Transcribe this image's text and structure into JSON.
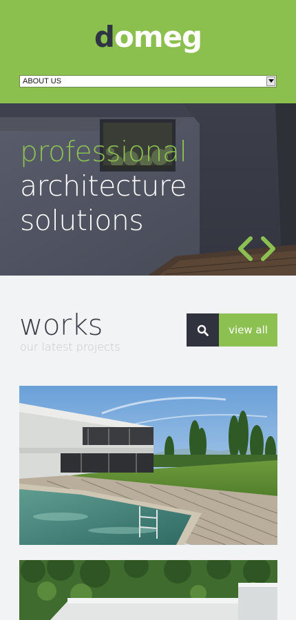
{
  "header": {
    "logo_first": "d",
    "logo_rest": "omeg",
    "nav_select_value": "ABOUT US"
  },
  "hero": {
    "line1": "professional",
    "line2": "architecture",
    "line3": "solutions",
    "prev_icon": "chevron-left-icon",
    "next_icon": "chevron-right-icon"
  },
  "works": {
    "title": "works",
    "subtitle": "our latest projects",
    "search_icon": "search-icon",
    "view_all_label": "view all"
  },
  "projects": [
    {
      "image": "modern-house-with-pool"
    },
    {
      "image": "white-building-on-hillside"
    }
  ],
  "colors": {
    "accent_green": "#8cc152",
    "dark": "#30323e",
    "hero_bg": "#4a4d5b"
  }
}
